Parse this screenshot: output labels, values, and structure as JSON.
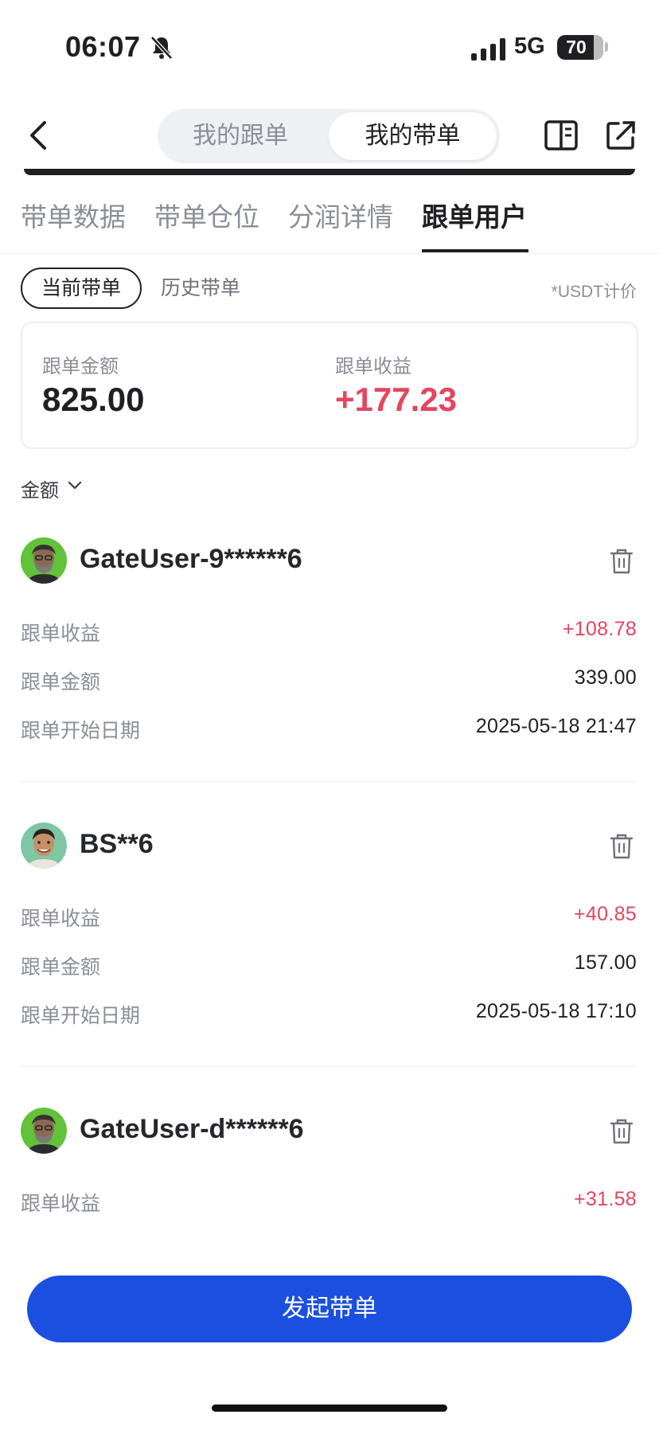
{
  "status_bar": {
    "time": "06:07",
    "network": "5G",
    "battery": "70"
  },
  "header": {
    "segments": [
      "我的跟单",
      "我的带单"
    ],
    "active_segment": 1
  },
  "tabs": [
    {
      "label": "带单数据"
    },
    {
      "label": "带单仓位"
    },
    {
      "label": "分润详情"
    },
    {
      "label": "跟单用户"
    }
  ],
  "active_tab": 3,
  "filters": {
    "current": "当前带单",
    "history": "历史带单",
    "unit_note": "*USDT计价"
  },
  "summary": {
    "amount_label": "跟单金额",
    "amount_value": "825.00",
    "profit_label": "跟单收益",
    "profit_value": "+177.23"
  },
  "sort": {
    "label": "金额"
  },
  "followers": [
    {
      "name": "GateUser-9******6",
      "rows": [
        {
          "label": "跟单收益",
          "value": "+108.78"
        },
        {
          "label": "跟单金额",
          "value": "339.00"
        },
        {
          "label": "跟单开始日期",
          "value": "2025-05-18 21:47"
        }
      ]
    },
    {
      "name": "BS**6",
      "rows": [
        {
          "label": "跟单收益",
          "value": "+40.85"
        },
        {
          "label": "跟单金额",
          "value": "157.00"
        },
        {
          "label": "跟单开始日期",
          "value": "2025-05-18 17:10"
        }
      ]
    },
    {
      "name": "GateUser-d******6",
      "rows": [
        {
          "label": "跟单收益",
          "value": "+31.58"
        }
      ]
    }
  ],
  "cta": {
    "label": "发起带单"
  },
  "icons": [
    "bell-muted-icon",
    "signal-icon",
    "battery-icon",
    "back-arrow-icon",
    "book-icon",
    "share-icon",
    "chevron-down-icon",
    "trash-icon",
    "avatar"
  ],
  "colors": {
    "accent_blue": "#1b4fe0",
    "profit_red": "#e5455e",
    "text": "#1f1f24",
    "muted": "#8b8e97"
  }
}
